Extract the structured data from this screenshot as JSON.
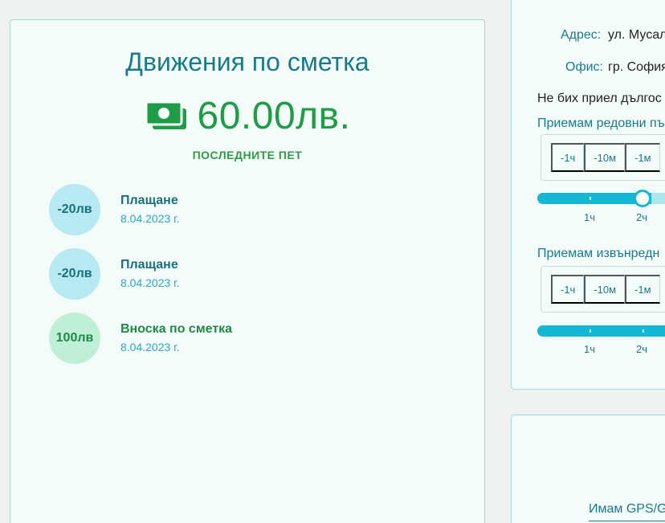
{
  "account": {
    "title": "Движения по сметка",
    "balance": "60.00лв.",
    "subtitle": "ПОСЛЕДНИТЕ ПЕТ",
    "transactions": [
      {
        "amount": "-20лв",
        "title": "Плащане",
        "date": "8.04.2023 г.",
        "kind": "neg"
      },
      {
        "amount": "-20лв",
        "title": "Плащане",
        "date": "8.04.2023 г.",
        "kind": "neg"
      },
      {
        "amount": "100лв",
        "title": "Вноска по сметка",
        "date": "8.04.2023 г.",
        "kind": "pos"
      }
    ]
  },
  "profile": {
    "address_label": "Адрес:",
    "address_value": "ул. Мусал",
    "office_label": "Офис:",
    "office_value": "гр. София",
    "note": "Не бих приел дългос",
    "regular_label": "Приемам редовни пъ",
    "emergency_label": "Приемам извънредн",
    "time_buttons": [
      "-1ч",
      "-10м",
      "-1м"
    ],
    "slider_labels": [
      "1ч",
      "2ч"
    ],
    "gps_label": "Имам GPS/G"
  },
  "colors": {
    "teal": "#1a7a8a",
    "green": "#1e9c46",
    "slider": "#14b8d4"
  }
}
